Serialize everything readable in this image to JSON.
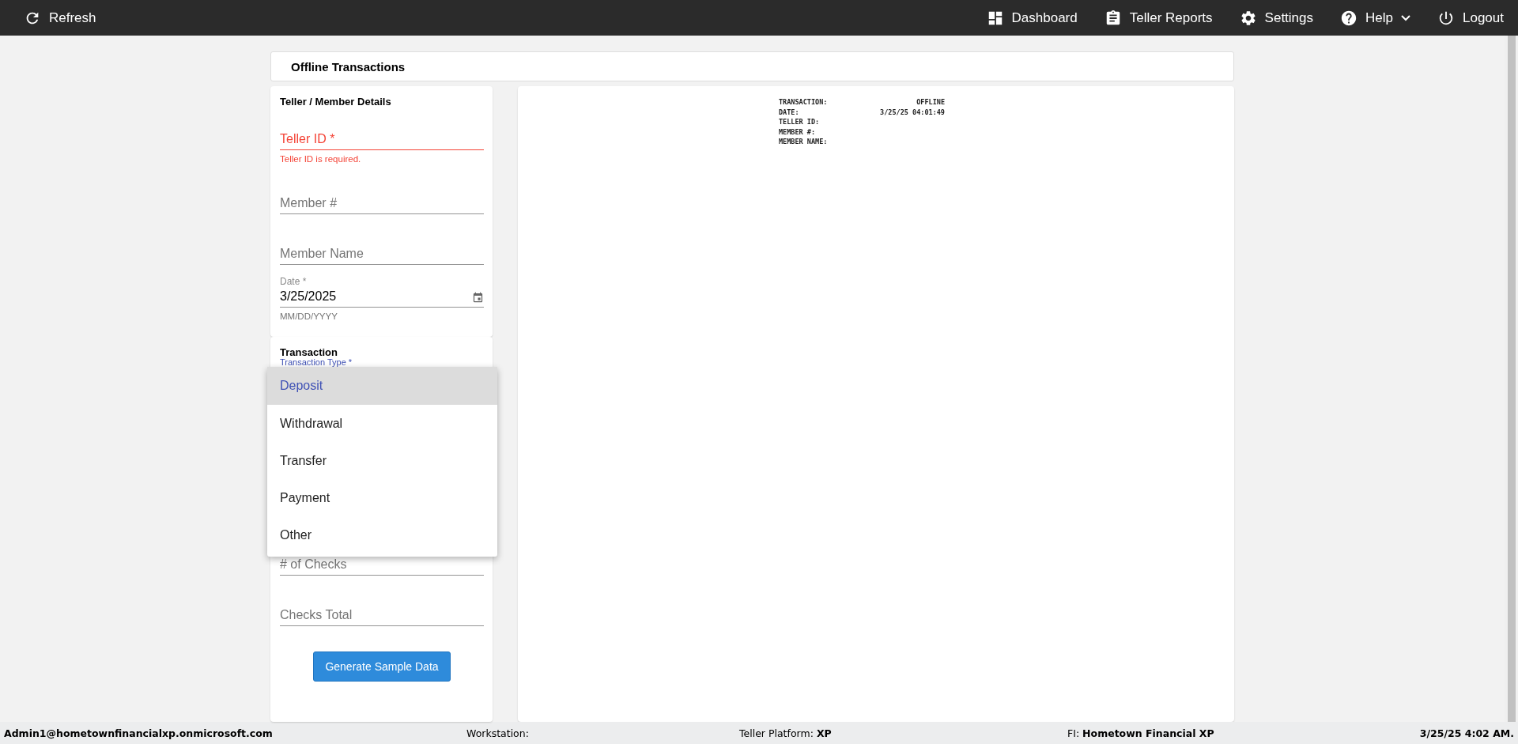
{
  "topbar": {
    "left": [
      {
        "kind": "refresh",
        "label": "Refresh"
      }
    ],
    "right": [
      {
        "kind": "dashboard",
        "label": "Dashboard",
        "dropdown": false
      },
      {
        "kind": "clipboard",
        "label": "Teller Reports",
        "dropdown": false
      },
      {
        "kind": "gear",
        "label": "Settings",
        "dropdown": false
      },
      {
        "kind": "help",
        "label": "Help",
        "dropdown": true
      },
      {
        "kind": "power",
        "label": "Logout",
        "dropdown": false
      }
    ]
  },
  "page_title": "Offline Transactions",
  "details": {
    "title": "Teller / Member Details",
    "fields": [
      {
        "kind": "text",
        "label": "Teller ID *",
        "invalid": true,
        "error": "Teller ID is required."
      },
      {
        "kind": "text",
        "label": "Member #",
        "invalid": false
      },
      {
        "kind": "text",
        "label": "Member Name",
        "invalid": false
      },
      {
        "kind": "date",
        "label": "Date *",
        "value": "3/25/2025",
        "helper": "MM/DD/YYYY",
        "invalid": false
      }
    ]
  },
  "transaction": {
    "title": "Transaction",
    "select": {
      "label": "Transaction Type *",
      "options": [
        {
          "label": "Deposit",
          "selected": true
        },
        {
          "label": "Withdrawal",
          "selected": false
        },
        {
          "label": "Transfer",
          "selected": false
        },
        {
          "label": "Payment",
          "selected": false
        },
        {
          "label": "Other",
          "selected": false
        }
      ]
    },
    "fields": [
      {
        "kind": "text",
        "label": "# of Checks",
        "invalid": false
      },
      {
        "kind": "text",
        "label": "Checks Total",
        "invalid": false
      }
    ],
    "button": "Generate Sample Data"
  },
  "receipt": [
    {
      "label": "TRANSACTION:",
      "value": "OFFLINE"
    },
    {
      "label": "DATE:",
      "value": "3/25/25 04:01:49"
    },
    {
      "label": "TELLER ID:"
    },
    {
      "label": "MEMBER #:"
    },
    {
      "label": "MEMBER NAME:"
    }
  ],
  "status_bar": {
    "user": "Admin1@hometownfinancialxp.onmicrosoft.com",
    "items": [
      {
        "label": "Workstation:"
      },
      {
        "label": "Teller Platform:",
        "value": "XP"
      },
      {
        "label": "FI:",
        "value": "Hometown Financial XP"
      }
    ],
    "time": "3/25/25 4:02 AM."
  }
}
